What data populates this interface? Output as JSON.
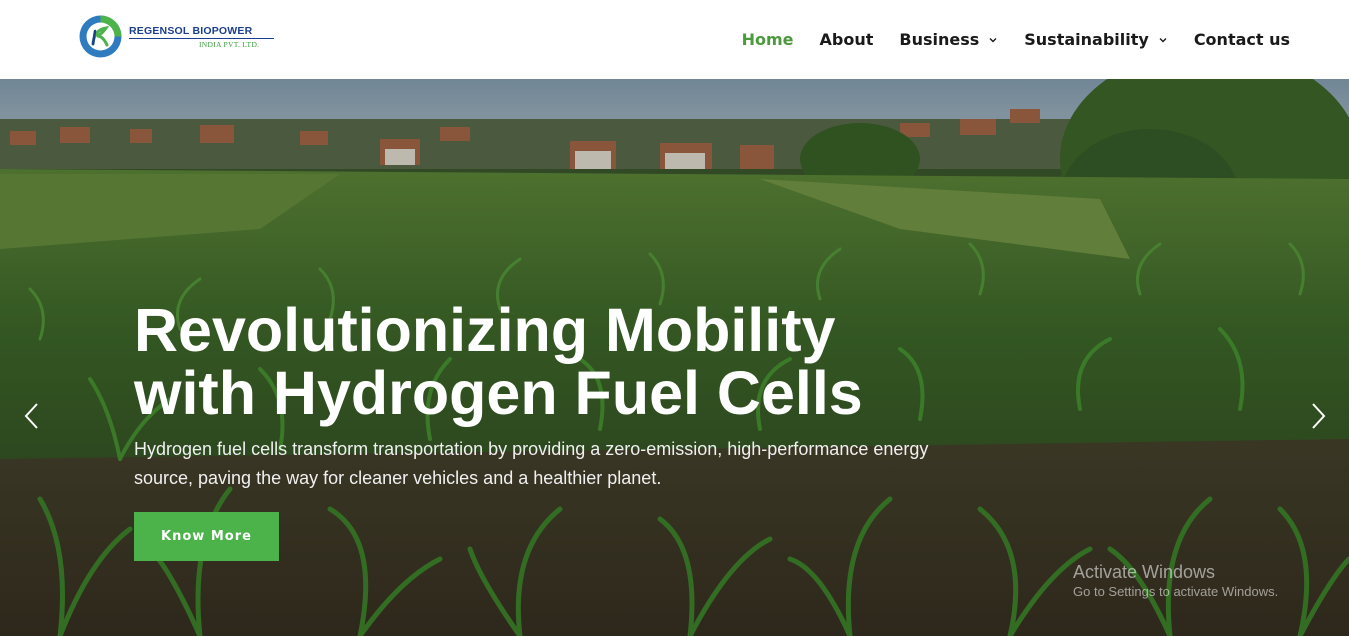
{
  "brand": {
    "name": "REGENSOL BIOPOWER",
    "sub": "INDIA PVT. LTD.",
    "colors": {
      "green": "#4b9a3d",
      "blue": "#1b3f8f",
      "button": "#4bb34a"
    }
  },
  "nav": {
    "items": [
      {
        "label": "Home",
        "active": true,
        "dropdown": false
      },
      {
        "label": "About",
        "active": false,
        "dropdown": false
      },
      {
        "label": "Business",
        "active": false,
        "dropdown": true
      },
      {
        "label": "Sustainability",
        "active": false,
        "dropdown": true
      },
      {
        "label": "Contact us",
        "active": false,
        "dropdown": false
      }
    ]
  },
  "hero": {
    "title_line1": "Revolutionizing Mobility",
    "title_line2": "with Hydrogen Fuel Cells",
    "text_line1": "Hydrogen fuel cells transform transportation by providing a zero-emission, high-performance energy",
    "text_line2": "source, paving the way for cleaner vehicles and a healthier planet.",
    "button_label": "Know More",
    "prev_icon": "chevron-left-icon",
    "next_icon": "chevron-right-icon"
  },
  "watermark": {
    "line1": "Activate Windows",
    "line2": "Go to Settings to activate Windows."
  }
}
